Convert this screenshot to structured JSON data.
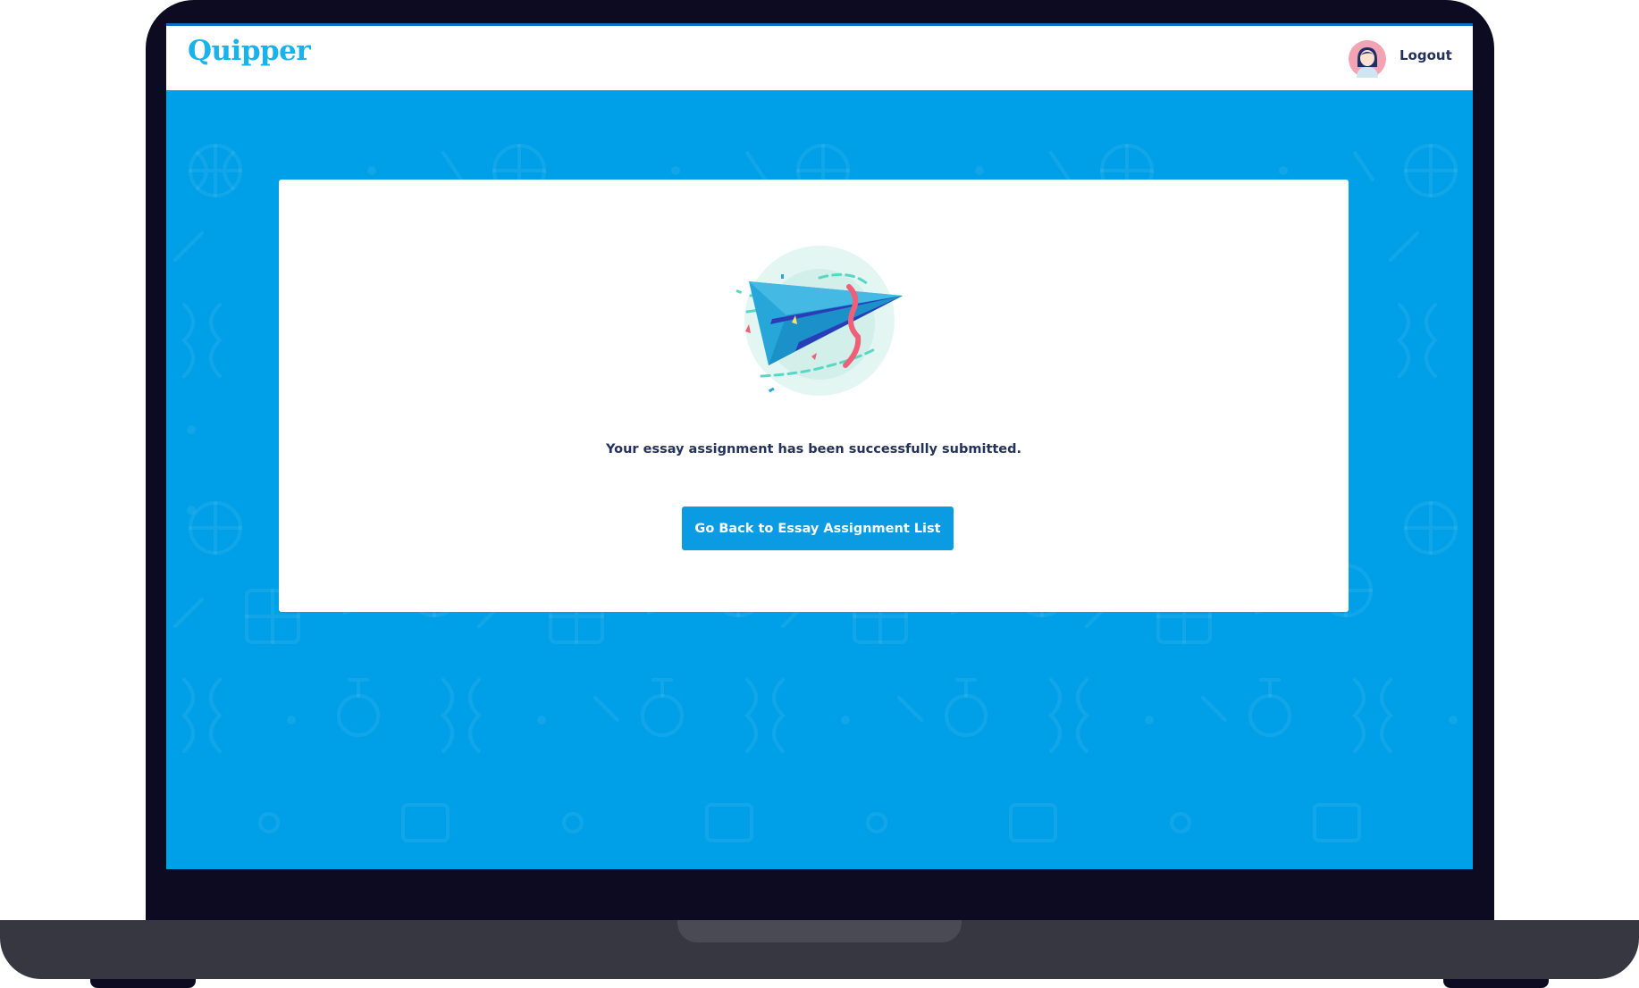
{
  "header": {
    "logo_text": "Quipper",
    "logout_label": "Logout",
    "avatar_icon": "user-avatar"
  },
  "main": {
    "illustration_icon": "paper-plane-icon",
    "message": "Your essay assignment has been successfully submitted.",
    "back_button_label": "Go Back to Essay Assignment List"
  },
  "colors": {
    "brand_blue": "#00a0e8",
    "button_blue": "#0a9be3",
    "logo_blue": "#1ab2ec",
    "text_navy": "#23325a",
    "device_frame": "#0c0b22"
  }
}
